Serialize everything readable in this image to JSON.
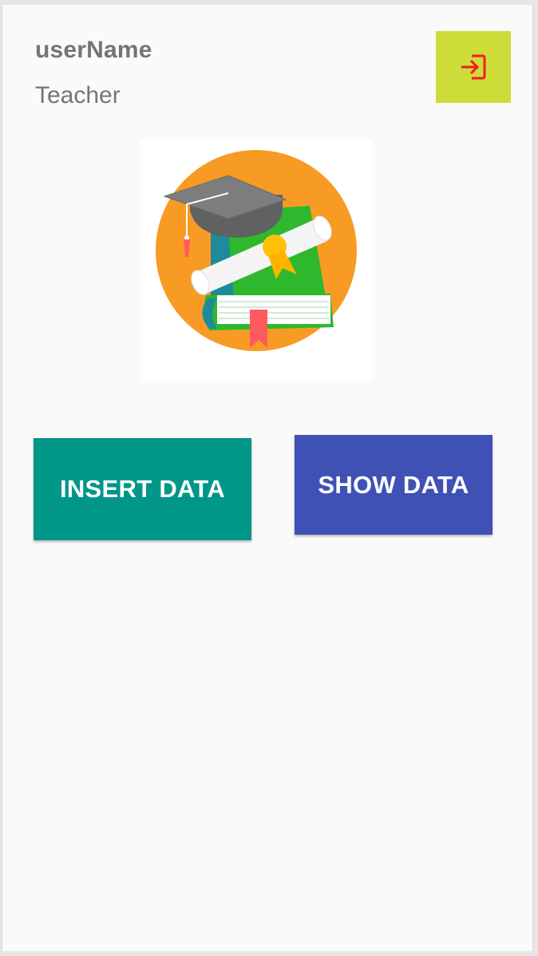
{
  "header": {
    "username": "userName",
    "role": "Teacher",
    "logout_icon": "login-arrow-icon",
    "logout_color": "#cddc39",
    "logout_icon_color": "#f21d1d"
  },
  "logo": {
    "icon": "graduation-cap-books-diploma-icon",
    "circle_color": "#f79b24"
  },
  "actions": {
    "insert_label": "INSERT DATA",
    "insert_color": "#009688",
    "show_label": "SHOW DATA",
    "show_color": "#3f51b5"
  }
}
